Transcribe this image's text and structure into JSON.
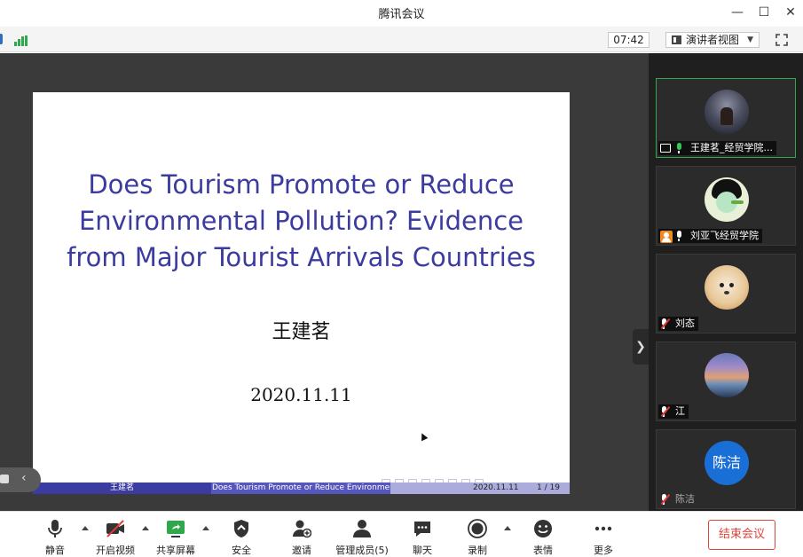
{
  "window": {
    "title": "腾讯会议"
  },
  "top_toolbar": {
    "time": "07:42",
    "view_label": "演讲者视图"
  },
  "slide": {
    "title_lines": [
      "Does Tourism Promote or Reduce",
      "Environmental Pollution? Evidence",
      "from Major Tourist Arrivals Countries"
    ],
    "author": "王建茗",
    "date": "2020.11.11",
    "footer": {
      "author": "王建茗",
      "short_title": "Does Tourism Promote or Reduce Environmental Pollution?",
      "date": "2020.11.11",
      "page": "1 / 19"
    }
  },
  "participants": [
    {
      "name": "王建茗_经贸学院...",
      "status": "sharing-speaking"
    },
    {
      "name": "刘亚飞经贸学院",
      "status": "host-speaking"
    },
    {
      "name": "刘态",
      "status": "muted"
    },
    {
      "name": "江",
      "status": "muted"
    },
    {
      "name": "陈洁",
      "status": "muted",
      "avatar_text": "陈洁"
    }
  ],
  "bottom_toolbar": {
    "mute": "静音",
    "video": "开启视频",
    "share": "共享屏幕",
    "security": "安全",
    "invite": "邀请",
    "members": "管理成员(5)",
    "chat": "聊天",
    "record": "录制",
    "reaction": "表情",
    "more": "更多",
    "end": "结束会议"
  },
  "colors": {
    "accent_green": "#2ea84a",
    "end_red": "#e0433a",
    "slide_blue": "#3b3ba0"
  }
}
